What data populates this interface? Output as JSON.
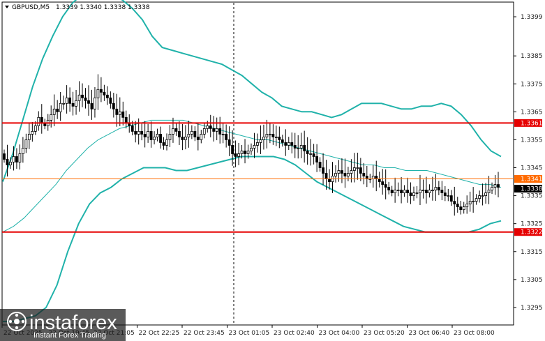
{
  "header": {
    "symbol": "GBPUSD,M5",
    "ohlc": "1.3339 1.3340 1.3338 1.3338"
  },
  "colors": {
    "background": "#ffffff",
    "candle": "#000000",
    "bollinger_outer": "#20b2aa",
    "bollinger_middle": "#20b2aa",
    "level_line": "#e60000",
    "current_line": "#ff6a00",
    "price_tag_current": "#000000"
  },
  "chart_data": {
    "type": "candlestick",
    "symbol": "GBPUSD",
    "timeframe": "M5",
    "ylim": [
      1.3289,
      1.3404
    ],
    "y_ticks": [
      "1.3399",
      "1.3385",
      "1.3375",
      "1.3365",
      "1.3355",
      "1.3345",
      "1.3335",
      "1.3325",
      "1.3315",
      "1.3305",
      "1.3295"
    ],
    "x_ticks": [
      "22 Oct 2025",
      "22 Oct 19:45",
      "22 Oct 21:05",
      "22 Oct 22:25",
      "22 Oct 23:45",
      "23 Oct 01:05",
      "23 Oct 02:40",
      "23 Oct 04:00",
      "23 Oct 05:20",
      "23 Oct 06:40",
      "23 Oct 08:00"
    ],
    "levels": [
      {
        "price": 1.3361,
        "label": "1.3361",
        "kind": "resistance"
      },
      {
        "price": 1.3322,
        "label": "1.3322",
        "kind": "support"
      }
    ],
    "current_line": {
      "price": 1.3341,
      "label": "1.3341"
    },
    "last_price": {
      "price": 1.3338,
      "label": "1.3338"
    },
    "closes": [
      1.3348,
      1.3346,
      1.3347,
      1.3349,
      1.3347,
      1.335,
      1.3352,
      1.3355,
      1.3357,
      1.3358,
      1.336,
      1.3363,
      1.3361,
      1.336,
      1.3362,
      1.3364,
      1.3366,
      1.3365,
      1.3368,
      1.3368,
      1.337,
      1.3368,
      1.3367,
      1.3369,
      1.3371,
      1.337,
      1.3369,
      1.3368,
      1.3366,
      1.337,
      1.3373,
      1.3372,
      1.3371,
      1.337,
      1.3368,
      1.3366,
      1.3364,
      1.3365,
      1.3363,
      1.3361,
      1.336,
      1.3358,
      1.3357,
      1.3358,
      1.3357,
      1.3356,
      1.3358,
      1.3355,
      1.3356,
      1.3357,
      1.3354,
      1.3353,
      1.3355,
      1.3357,
      1.3359,
      1.3358,
      1.3356,
      1.3355,
      1.3356,
      1.3357,
      1.3358,
      1.3356,
      1.3355,
      1.3357,
      1.3359,
      1.336,
      1.3359,
      1.3358,
      1.3359,
      1.3357,
      1.3357,
      1.3355,
      1.3353,
      1.335,
      1.3349,
      1.335,
      1.3351,
      1.335,
      1.3351,
      1.3352,
      1.3353,
      1.3354,
      1.3355,
      1.3356,
      1.3357,
      1.3357,
      1.3356,
      1.3356,
      1.3355,
      1.3354,
      1.3353,
      1.3354,
      1.3353,
      1.3352,
      1.3352,
      1.3353,
      1.3351,
      1.335,
      1.335,
      1.3349,
      1.3347,
      1.3345,
      1.3343,
      1.3341,
      1.334,
      1.3342,
      1.3343,
      1.3344,
      1.3343,
      1.3342,
      1.3343,
      1.3344,
      1.3345,
      1.3345,
      1.3343,
      1.3342,
      1.3341,
      1.3341,
      1.3342,
      1.3341,
      1.334,
      1.3339,
      1.3338,
      1.3337,
      1.3336,
      1.3337,
      1.3337,
      1.3336,
      1.3337,
      1.3336,
      1.3335,
      1.3336,
      1.3336,
      1.3337,
      1.3337,
      1.3336,
      1.3337,
      1.3337,
      1.3338,
      1.3337,
      1.3336,
      1.3335,
      1.3335,
      1.3333,
      1.3332,
      1.3331,
      1.333,
      1.3331,
      1.3332,
      1.3333,
      1.3333,
      1.3334,
      1.3335,
      1.3335,
      1.3336,
      1.3337,
      1.3338,
      1.3339,
      1.3338
    ],
    "bb_upper": [
      1.334,
      1.335,
      1.3362,
      1.3374,
      1.3384,
      1.3392,
      1.3399,
      1.3404,
      1.3407,
      1.3408,
      1.3408,
      1.3407,
      1.3405,
      1.3402,
      1.3398,
      1.3392,
      1.3388,
      1.3387,
      1.3386,
      1.3385,
      1.3384,
      1.3383,
      1.3382,
      1.338,
      1.3378,
      1.3375,
      1.3372,
      1.337,
      1.3367,
      1.3366,
      1.3365,
      1.3365,
      1.3364,
      1.3363,
      1.3364,
      1.3366,
      1.3368,
      1.3368,
      1.3368,
      1.3367,
      1.3366,
      1.3366,
      1.3367,
      1.3367,
      1.3368,
      1.3367,
      1.3364,
      1.336,
      1.3355,
      1.3351,
      1.3349
    ],
    "bb_middle": [
      1.3322,
      1.3324,
      1.3327,
      1.3331,
      1.3335,
      1.3339,
      1.3344,
      1.3348,
      1.3352,
      1.3355,
      1.3357,
      1.3359,
      1.336,
      1.3361,
      1.3362,
      1.3362,
      1.3362,
      1.3362,
      1.3361,
      1.336,
      1.3359,
      1.3358,
      1.3357,
      1.3356,
      1.3355,
      1.3355,
      1.3354,
      1.3353,
      1.3352,
      1.3351,
      1.335,
      1.3349,
      1.3348,
      1.3347,
      1.3346,
      1.3346,
      1.3345,
      1.3345,
      1.3344,
      1.3344,
      1.3344,
      1.3343,
      1.3342,
      1.3341,
      1.334,
      1.3339,
      1.3339,
      1.3338
    ],
    "bb_lower": [
      1.329,
      1.329,
      1.3291,
      1.3292,
      1.3295,
      1.3303,
      1.3315,
      1.3325,
      1.3332,
      1.3336,
      1.3338,
      1.3341,
      1.3343,
      1.3345,
      1.3345,
      1.3345,
      1.3344,
      1.3344,
      1.3345,
      1.3346,
      1.3347,
      1.3348,
      1.3349,
      1.3349,
      1.3349,
      1.3349,
      1.3348,
      1.3346,
      1.3343,
      1.334,
      1.3338,
      1.3336,
      1.3334,
      1.3332,
      1.333,
      1.3328,
      1.3326,
      1.3324,
      1.3323,
      1.3322,
      1.3322,
      1.3322,
      1.3322,
      1.3322,
      1.3323,
      1.3325,
      1.3326
    ]
  },
  "price_tags": {
    "resistance": "1.3361",
    "current": "1.3341",
    "last": "1.3338",
    "support": "1.3322"
  },
  "watermark": {
    "brand": "instaforex",
    "tagline": "Instant Forex Trading"
  }
}
